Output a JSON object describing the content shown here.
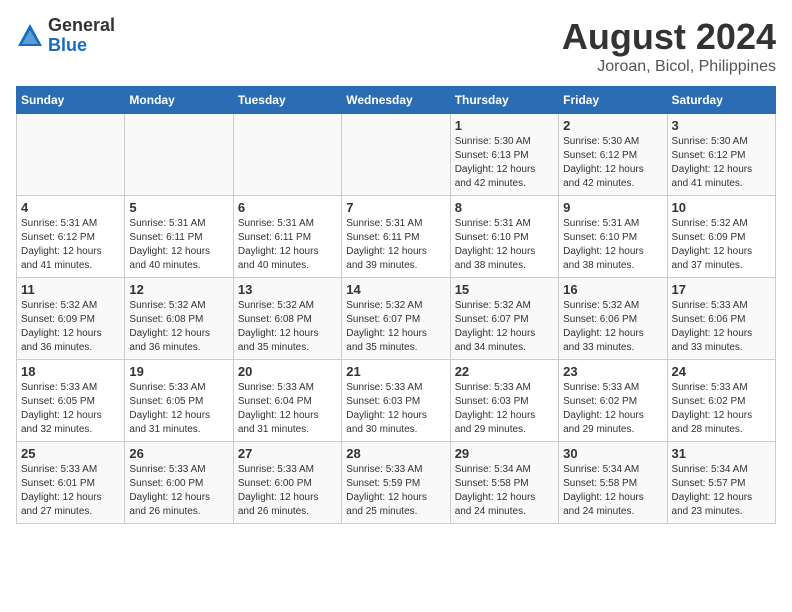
{
  "header": {
    "logo_general": "General",
    "logo_blue": "Blue",
    "title": "August 2024",
    "subtitle": "Joroan, Bicol, Philippines"
  },
  "calendar": {
    "weekdays": [
      "Sunday",
      "Monday",
      "Tuesday",
      "Wednesday",
      "Thursday",
      "Friday",
      "Saturday"
    ],
    "weeks": [
      [
        {
          "day": "",
          "info": ""
        },
        {
          "day": "",
          "info": ""
        },
        {
          "day": "",
          "info": ""
        },
        {
          "day": "",
          "info": ""
        },
        {
          "day": "1",
          "info": "Sunrise: 5:30 AM\nSunset: 6:13 PM\nDaylight: 12 hours\nand 42 minutes."
        },
        {
          "day": "2",
          "info": "Sunrise: 5:30 AM\nSunset: 6:12 PM\nDaylight: 12 hours\nand 42 minutes."
        },
        {
          "day": "3",
          "info": "Sunrise: 5:30 AM\nSunset: 6:12 PM\nDaylight: 12 hours\nand 41 minutes."
        }
      ],
      [
        {
          "day": "4",
          "info": "Sunrise: 5:31 AM\nSunset: 6:12 PM\nDaylight: 12 hours\nand 41 minutes."
        },
        {
          "day": "5",
          "info": "Sunrise: 5:31 AM\nSunset: 6:11 PM\nDaylight: 12 hours\nand 40 minutes."
        },
        {
          "day": "6",
          "info": "Sunrise: 5:31 AM\nSunset: 6:11 PM\nDaylight: 12 hours\nand 40 minutes."
        },
        {
          "day": "7",
          "info": "Sunrise: 5:31 AM\nSunset: 6:11 PM\nDaylight: 12 hours\nand 39 minutes."
        },
        {
          "day": "8",
          "info": "Sunrise: 5:31 AM\nSunset: 6:10 PM\nDaylight: 12 hours\nand 38 minutes."
        },
        {
          "day": "9",
          "info": "Sunrise: 5:31 AM\nSunset: 6:10 PM\nDaylight: 12 hours\nand 38 minutes."
        },
        {
          "day": "10",
          "info": "Sunrise: 5:32 AM\nSunset: 6:09 PM\nDaylight: 12 hours\nand 37 minutes."
        }
      ],
      [
        {
          "day": "11",
          "info": "Sunrise: 5:32 AM\nSunset: 6:09 PM\nDaylight: 12 hours\nand 36 minutes."
        },
        {
          "day": "12",
          "info": "Sunrise: 5:32 AM\nSunset: 6:08 PM\nDaylight: 12 hours\nand 36 minutes."
        },
        {
          "day": "13",
          "info": "Sunrise: 5:32 AM\nSunset: 6:08 PM\nDaylight: 12 hours\nand 35 minutes."
        },
        {
          "day": "14",
          "info": "Sunrise: 5:32 AM\nSunset: 6:07 PM\nDaylight: 12 hours\nand 35 minutes."
        },
        {
          "day": "15",
          "info": "Sunrise: 5:32 AM\nSunset: 6:07 PM\nDaylight: 12 hours\nand 34 minutes."
        },
        {
          "day": "16",
          "info": "Sunrise: 5:32 AM\nSunset: 6:06 PM\nDaylight: 12 hours\nand 33 minutes."
        },
        {
          "day": "17",
          "info": "Sunrise: 5:33 AM\nSunset: 6:06 PM\nDaylight: 12 hours\nand 33 minutes."
        }
      ],
      [
        {
          "day": "18",
          "info": "Sunrise: 5:33 AM\nSunset: 6:05 PM\nDaylight: 12 hours\nand 32 minutes."
        },
        {
          "day": "19",
          "info": "Sunrise: 5:33 AM\nSunset: 6:05 PM\nDaylight: 12 hours\nand 31 minutes."
        },
        {
          "day": "20",
          "info": "Sunrise: 5:33 AM\nSunset: 6:04 PM\nDaylight: 12 hours\nand 31 minutes."
        },
        {
          "day": "21",
          "info": "Sunrise: 5:33 AM\nSunset: 6:03 PM\nDaylight: 12 hours\nand 30 minutes."
        },
        {
          "day": "22",
          "info": "Sunrise: 5:33 AM\nSunset: 6:03 PM\nDaylight: 12 hours\nand 29 minutes."
        },
        {
          "day": "23",
          "info": "Sunrise: 5:33 AM\nSunset: 6:02 PM\nDaylight: 12 hours\nand 29 minutes."
        },
        {
          "day": "24",
          "info": "Sunrise: 5:33 AM\nSunset: 6:02 PM\nDaylight: 12 hours\nand 28 minutes."
        }
      ],
      [
        {
          "day": "25",
          "info": "Sunrise: 5:33 AM\nSunset: 6:01 PM\nDaylight: 12 hours\nand 27 minutes."
        },
        {
          "day": "26",
          "info": "Sunrise: 5:33 AM\nSunset: 6:00 PM\nDaylight: 12 hours\nand 26 minutes."
        },
        {
          "day": "27",
          "info": "Sunrise: 5:33 AM\nSunset: 6:00 PM\nDaylight: 12 hours\nand 26 minutes."
        },
        {
          "day": "28",
          "info": "Sunrise: 5:33 AM\nSunset: 5:59 PM\nDaylight: 12 hours\nand 25 minutes."
        },
        {
          "day": "29",
          "info": "Sunrise: 5:34 AM\nSunset: 5:58 PM\nDaylight: 12 hours\nand 24 minutes."
        },
        {
          "day": "30",
          "info": "Sunrise: 5:34 AM\nSunset: 5:58 PM\nDaylight: 12 hours\nand 24 minutes."
        },
        {
          "day": "31",
          "info": "Sunrise: 5:34 AM\nSunset: 5:57 PM\nDaylight: 12 hours\nand 23 minutes."
        }
      ]
    ]
  }
}
